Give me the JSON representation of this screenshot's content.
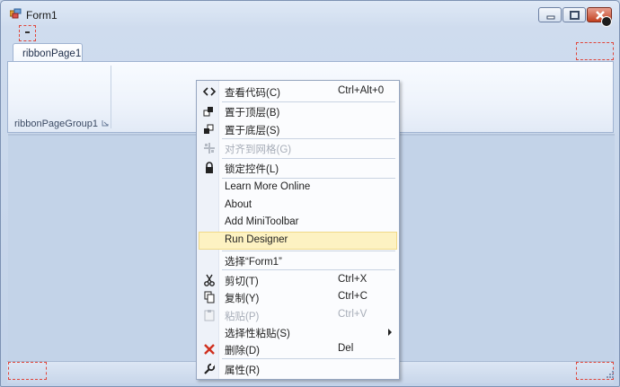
{
  "window": {
    "title": "Form1"
  },
  "ribbon": {
    "tab_label": "ribbonPage1",
    "group_label": "ribbonPageGroup1"
  },
  "context_menu": {
    "items": [
      {
        "label": "查看代码(C)",
        "shortcut": "Ctrl+Alt+0",
        "icon": "code-view-icon"
      },
      {
        "label": "置于顶层(B)",
        "icon": "bring-to-front-icon"
      },
      {
        "label": "置于底层(S)",
        "icon": "send-to-back-icon"
      },
      {
        "label": "对齐到网格(G)",
        "icon": "align-to-grid-icon",
        "disabled": true
      },
      {
        "label": "锁定控件(L)",
        "icon": "lock-icon"
      },
      {
        "label": "Learn More Online"
      },
      {
        "label": "About"
      },
      {
        "label": "Add MiniToolbar"
      },
      {
        "label": "Run Designer",
        "highlighted": true
      },
      {
        "label": "选择“Form1”"
      },
      {
        "label": "剪切(T)",
        "shortcut": "Ctrl+X",
        "icon": "cut-icon"
      },
      {
        "label": "复制(Y)",
        "shortcut": "Ctrl+C",
        "icon": "copy-icon"
      },
      {
        "label": "粘贴(P)",
        "shortcut": "Ctrl+V",
        "icon": "paste-icon",
        "disabled": true
      },
      {
        "label": "选择性粘贴(S)",
        "icon": "submenu-arrow-icon"
      },
      {
        "label": "删除(D)",
        "shortcut": "Del",
        "icon": "delete-icon"
      },
      {
        "label": "属性(R)",
        "icon": "properties-wrench-icon"
      }
    ]
  },
  "colors": {
    "highlight": "#fdf2c2",
    "delete_icon": "#d0301e",
    "selection_dash": "#e0453a"
  }
}
